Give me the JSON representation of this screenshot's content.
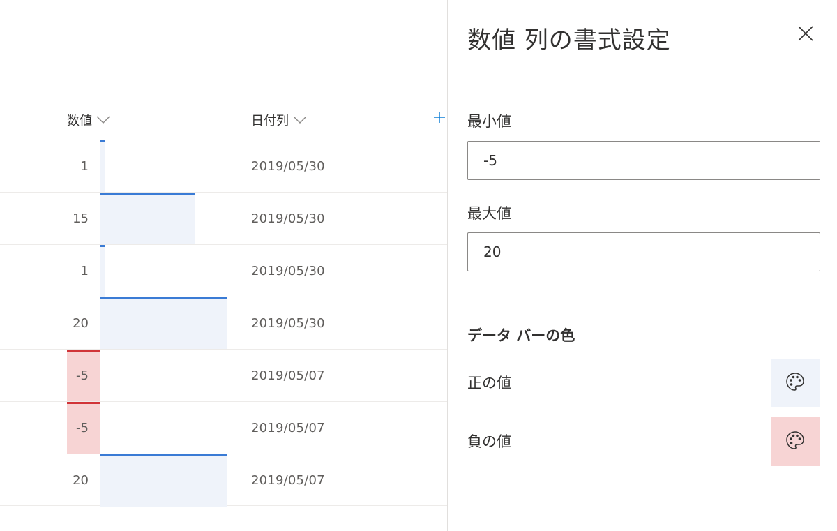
{
  "list": {
    "columns": {
      "number_header": "数値",
      "date_header": "日付列"
    },
    "rows": [
      {
        "value": "1",
        "date": "2019/05/30",
        "bar_fraction": 0.04
      },
      {
        "value": "15",
        "date": "2019/05/30",
        "bar_fraction": 0.75
      },
      {
        "value": "1",
        "date": "2019/05/30",
        "bar_fraction": 0.04
      },
      {
        "value": "20",
        "date": "2019/05/30",
        "bar_fraction": 1.0
      },
      {
        "value": "-5",
        "date": "2019/05/07",
        "bar_fraction": -1.0
      },
      {
        "value": "-5",
        "date": "2019/05/07",
        "bar_fraction": -1.0
      },
      {
        "value": "20",
        "date": "2019/05/07",
        "bar_fraction": 1.0
      }
    ]
  },
  "panel": {
    "title": "数値 列の書式設定",
    "min_label": "最小値",
    "min_value": "-5",
    "max_label": "最大値",
    "max_value": "20",
    "section_title": "データ バーの色",
    "positive_label": "正の値",
    "negative_label": "負の値"
  },
  "colors": {
    "positive_fill": "#eff3fa",
    "positive_line": "#3a7bd5",
    "negative_fill": "#f7d4d4",
    "negative_line": "#d13438"
  },
  "icons": {
    "close": "close-icon",
    "chevron": "chevron-down-icon",
    "add_column": "plus-icon",
    "palette": "palette-icon"
  }
}
